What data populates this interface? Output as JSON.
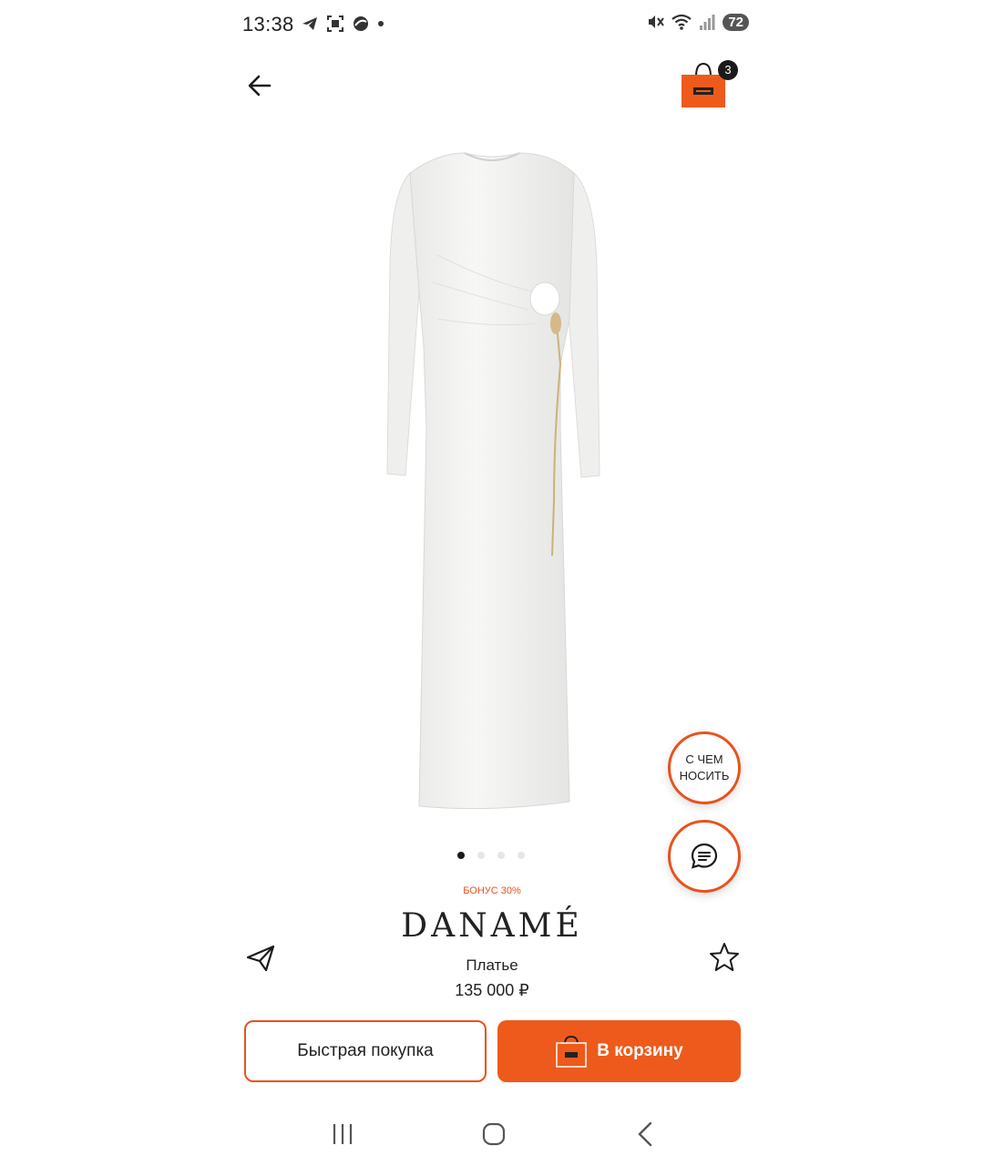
{
  "status_bar": {
    "time": "13:38",
    "battery": "72"
  },
  "header": {
    "cart_count": "3"
  },
  "product": {
    "image_dots": 4,
    "active_image": 0,
    "bonus": "БОНУС 30%",
    "brand": "DANAMÉ",
    "type": "Платье",
    "price": "135 000 ₽"
  },
  "floating": {
    "what_to_wear_line1": "С ЧЕМ",
    "what_to_wear_line2": "НОСИТЬ"
  },
  "actions": {
    "quick_buy": "Быстрая покупка",
    "add_to_cart": "В корзину"
  },
  "colors": {
    "accent": "#ed5a1c",
    "text": "#1a1a1a"
  }
}
